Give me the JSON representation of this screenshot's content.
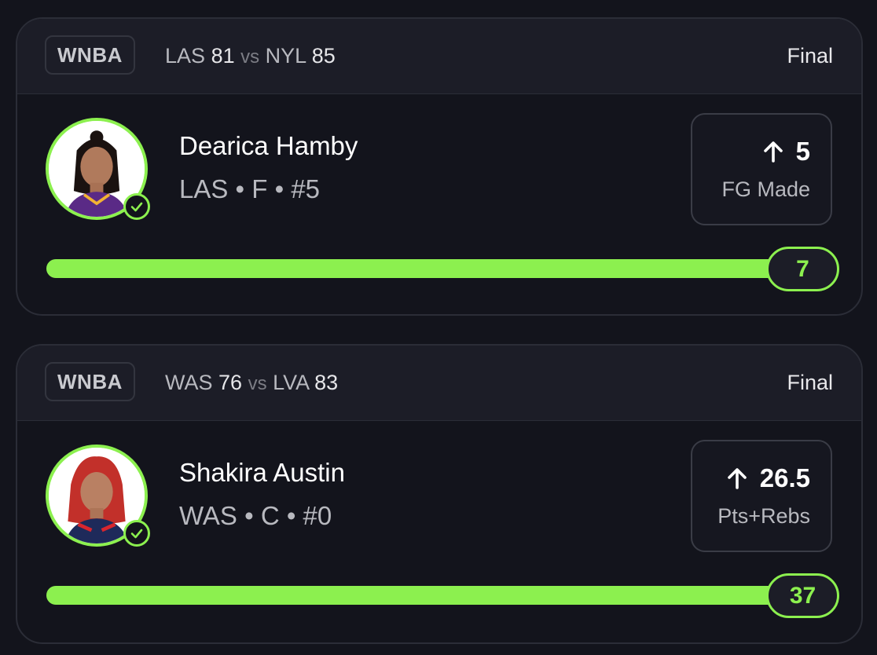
{
  "cards": [
    {
      "league": "WNBA",
      "away_team": "LAS",
      "away_score": "81",
      "vs": "vs",
      "home_team": "NYL",
      "home_score": "85",
      "status": "Final",
      "player_name": "Dearica Hamby",
      "player_meta": "LAS • F • #5",
      "direction_icon": "arrow-up-icon",
      "line": "5",
      "stat_label": "FG Made",
      "result": "7",
      "progress": 1.0
    },
    {
      "league": "WNBA",
      "away_team": "WAS",
      "away_score": "76",
      "vs": "vs",
      "home_team": "LVA",
      "home_score": "83",
      "status": "Final",
      "player_name": "Shakira Austin",
      "player_meta": "WAS • C • #0",
      "direction_icon": "arrow-up-icon",
      "line": "26.5",
      "stat_label": "Pts+Rebs",
      "result": "37",
      "progress": 1.0
    }
  ],
  "colors": {
    "background": "#13141c",
    "header": "#1c1d27",
    "accent": "#8cf04f",
    "muted_text": "#b8b9bf"
  }
}
